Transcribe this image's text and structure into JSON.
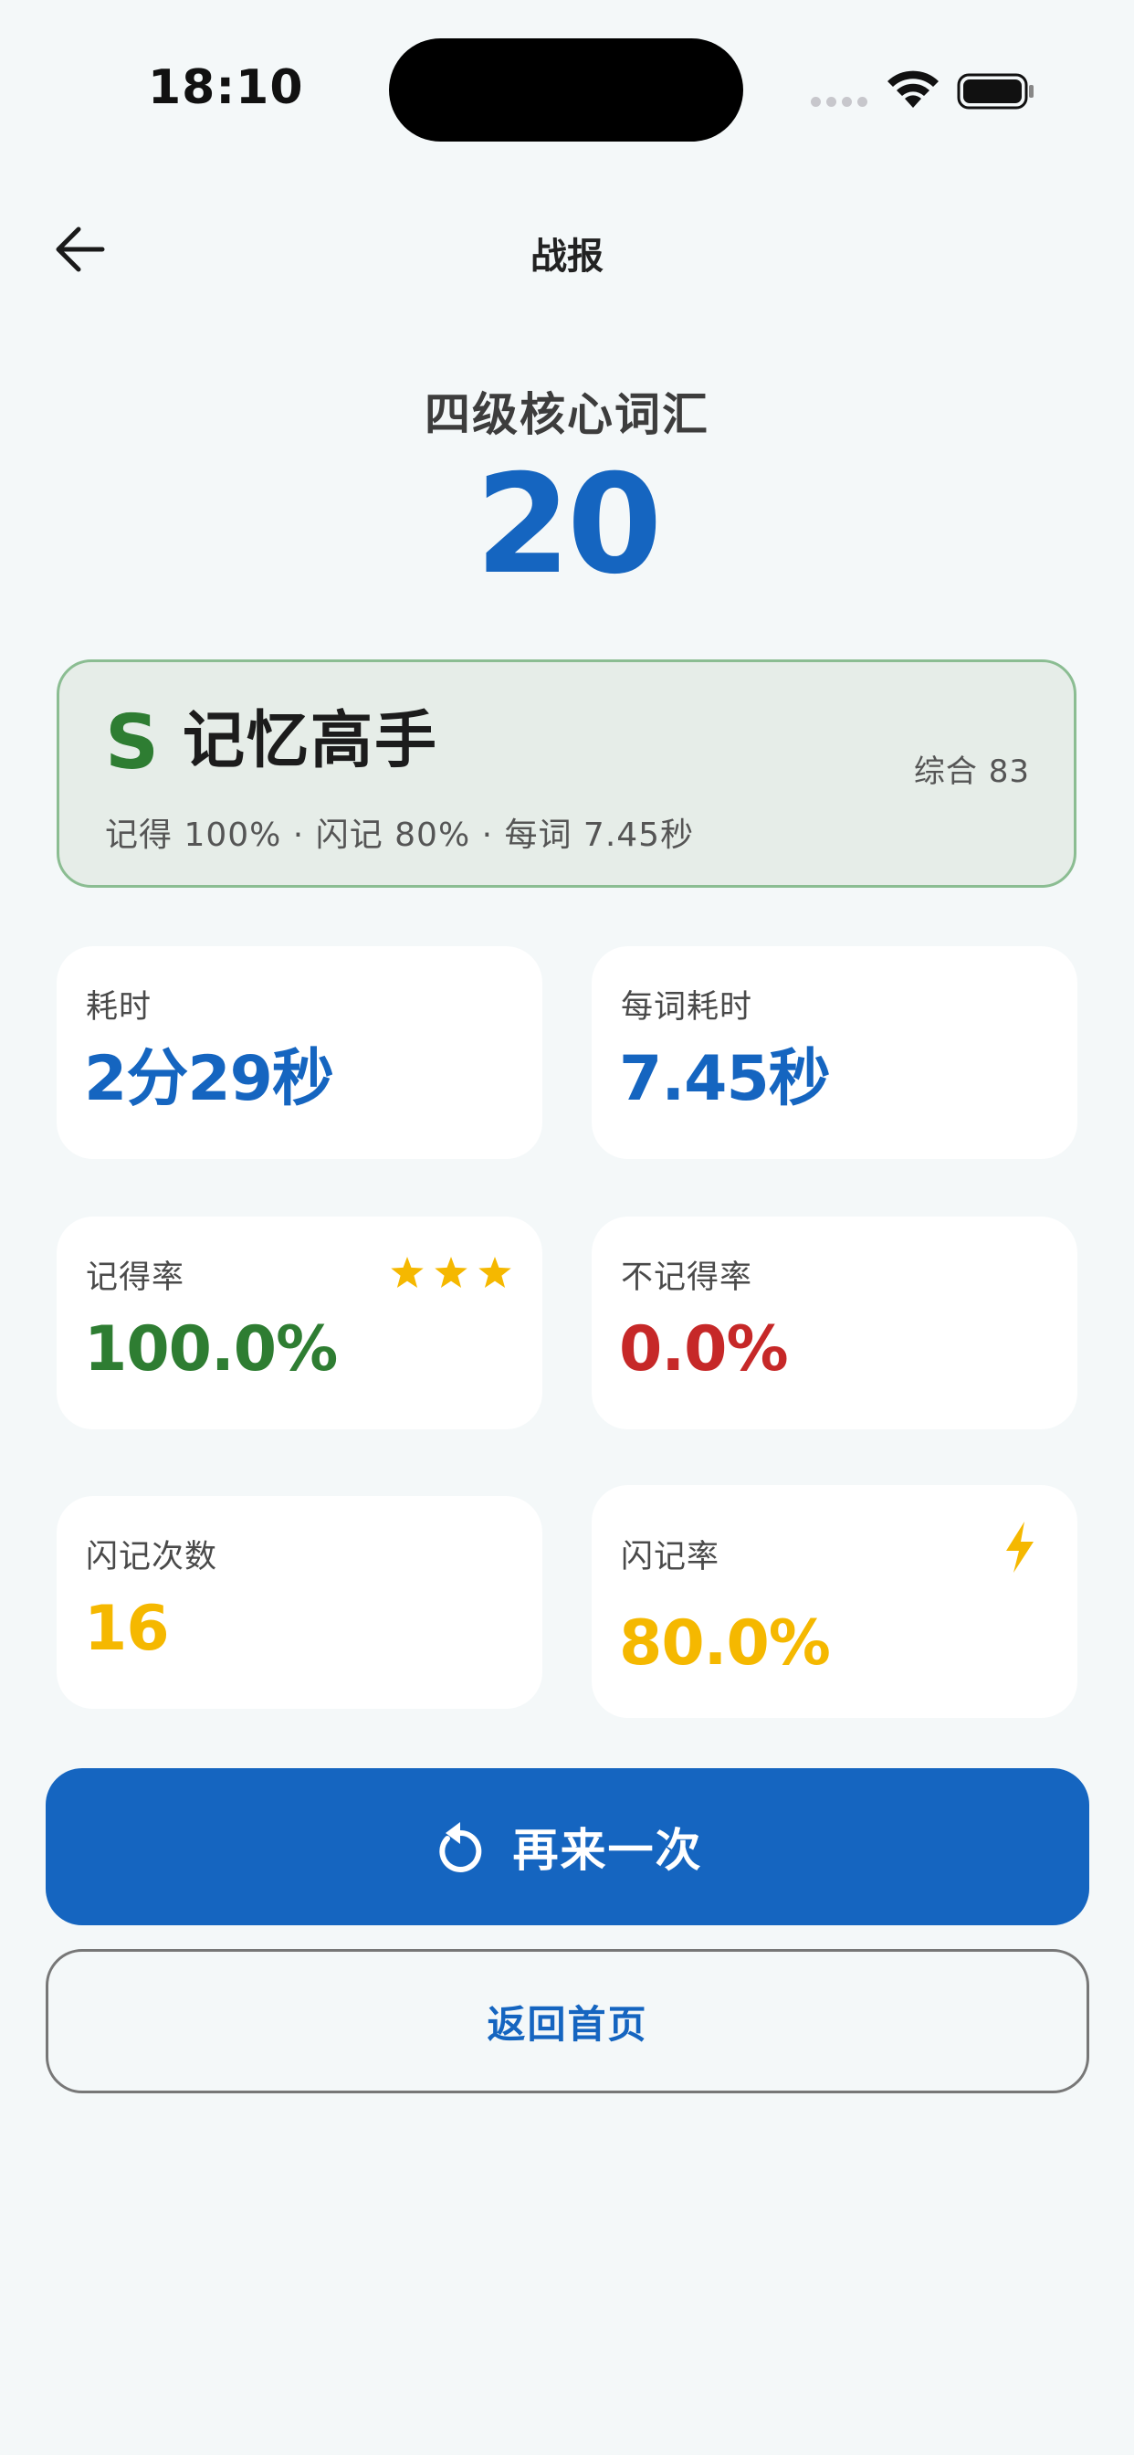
{
  "status_bar": {
    "time": "18:10"
  },
  "nav": {
    "title": "战报"
  },
  "header": {
    "deck_title": "四级核心词汇",
    "word_count": "20"
  },
  "grade": {
    "letter": "S",
    "name": "记忆高手",
    "score": "综合 83",
    "stats": "记得 100% · 闪记 80% · 每词 7.45秒"
  },
  "stats": {
    "time_label": "耗时",
    "time_value": "2分29秒",
    "per_word_label": "每词耗时",
    "per_word_value": "7.45秒",
    "remember_label": "记得率",
    "remember_value": "100.0%",
    "remember_stars": 3,
    "forget_label": "不记得率",
    "forget_value": "0.0%",
    "flash_count_label": "闪记次数",
    "flash_count_value": "16",
    "flash_rate_label": "闪记率",
    "flash_rate_value": "80.0%"
  },
  "actions": {
    "retry_label": "再来一次",
    "home_label": "返回首页"
  },
  "colors": {
    "primary": "#1565c0",
    "success": "#2e7d32",
    "danger": "#c62828",
    "warning": "#f5b800"
  }
}
